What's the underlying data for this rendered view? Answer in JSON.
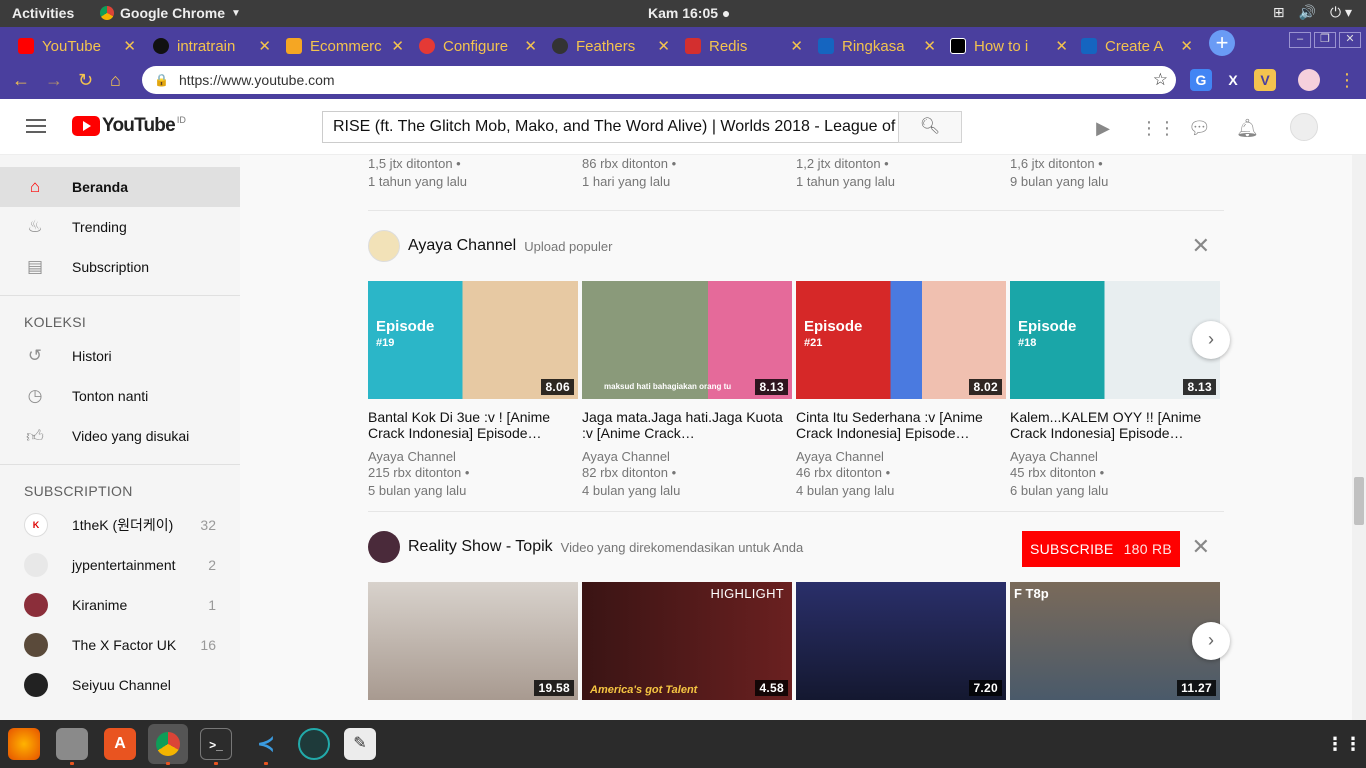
{
  "system": {
    "activities": "Activities",
    "app": "Google Chrome",
    "clock": "Kam 16:05"
  },
  "tabs": [
    {
      "label": "YouTube",
      "color": "#ff0000"
    },
    {
      "label": "intratrain",
      "color": "#111111"
    },
    {
      "label": "Ecommerc",
      "color": "#f5a623"
    },
    {
      "label": "Configure",
      "color": "#e53935"
    },
    {
      "label": "Feathers",
      "color": "#333333"
    },
    {
      "label": "Redis",
      "color": "#d32f2f"
    },
    {
      "label": "Ringkasa",
      "color": "#1565c0"
    },
    {
      "label": "How to i",
      "color": "#000000"
    },
    {
      "label": "Create A",
      "color": "#1565c0"
    }
  ],
  "browser": {
    "url": "https://www.youtube.com"
  },
  "youtube": {
    "logo": "YouTube",
    "country": "ID",
    "search_value": "RISE (ft. The Glitch Mob, Mako, and The Word Alive) | Worlds 2018 - League of L"
  },
  "sidebar": {
    "main": [
      {
        "label": "Beranda",
        "icon": "home-icon"
      },
      {
        "label": "Trending",
        "icon": "flame-icon"
      },
      {
        "label": "Subscription",
        "icon": "subscriptions-icon"
      }
    ],
    "koleksi_title": "KOLEKSI",
    "koleksi": [
      {
        "label": "Histori",
        "icon": "history-icon"
      },
      {
        "label": "Tonton nanti",
        "icon": "clock-icon"
      },
      {
        "label": "Video yang disukai",
        "icon": "thumbs-up-icon"
      }
    ],
    "subscription_title": "SUBSCRIPTION",
    "subscriptions": [
      {
        "label": "1theK (원더케이)",
        "count": "32",
        "color": "#ffffff"
      },
      {
        "label": "jypentertainment",
        "count": "2",
        "color": "#e8e8e8"
      },
      {
        "label": "Kiranime",
        "count": "1",
        "color": "#8b2e3a"
      },
      {
        "label": "The X Factor UK",
        "count": "16",
        "color": "#5a4a3a"
      },
      {
        "label": "Seiyuu Channel",
        "count": "",
        "color": "#222222"
      }
    ]
  },
  "top_row": [
    {
      "views": "1,5 jtx ditonton •",
      "age": "1 tahun yang lalu"
    },
    {
      "views": "86 rbx ditonton •",
      "age": "1 hari yang lalu"
    },
    {
      "views": "1,2 jtx ditonton •",
      "age": "1 tahun yang lalu"
    },
    {
      "views": "1,6 jtx ditonton •",
      "age": "9 bulan yang lalu"
    }
  ],
  "shelf1": {
    "channel": "Ayaya Channel",
    "subtitle": "Upload populer",
    "videos": [
      {
        "title": "Bantal Kok Di 3ue :v ! [Anime Crack Indonesia] Episode…",
        "channel": "Ayaya Channel",
        "views": "215 rbx ditonton •",
        "age": "5 bulan yang lalu",
        "duration": "8.06",
        "ep": "Episode",
        "epnum": "#19",
        "bg": "#2bb6c8"
      },
      {
        "title": "Jaga mata.Jaga hati.Jaga Kuota :v [Anime Crack…",
        "channel": "Ayaya Channel",
        "views": "82 rbx ditonton •",
        "age": "4 bulan yang lalu",
        "duration": "8.13",
        "caption": "maksud hati bahagiakan orang tu",
        "bg": "#7a6a8a"
      },
      {
        "title": "Cinta Itu Sederhana :v [Anime Crack Indonesia] Episode…",
        "channel": "Ayaya Channel",
        "views": "46 rbx ditonton •",
        "age": "4 bulan yang lalu",
        "duration": "8.02",
        "ep": "Episode",
        "epnum": "#21",
        "bg": "#d62828"
      },
      {
        "title": "Kalem...KALEM OYY !! [Anime Crack Indonesia] Episode…",
        "channel": "Ayaya Channel",
        "views": "45 rbx ditonton •",
        "age": "6 bulan yang lalu",
        "duration": "8.13",
        "ep": "Episode",
        "epnum": "#18",
        "bg": "#1aa6a8"
      }
    ]
  },
  "shelf2": {
    "channel": "Reality Show - Topik",
    "subtitle": "Video yang direkomendasikan untuk Anda",
    "subscribe": "SUBSCRIBE",
    "sub_count": "180 RB",
    "videos": [
      {
        "duration": "19.58",
        "bg": "#c9c2bc"
      },
      {
        "duration": "4.58",
        "bg": "#3a1414",
        "highlight": "HIGHLIGHT",
        "brand": "America's got Talent"
      },
      {
        "duration": "7.20",
        "bg": "#2a2f6a"
      },
      {
        "duration": "11.27",
        "bg": "#6a5a4a",
        "tag": "F T8p"
      }
    ]
  },
  "colors": {
    "accent": "#ff0000",
    "tab_bg": "#4a3f9e",
    "tab_text": "#f3c34f"
  }
}
